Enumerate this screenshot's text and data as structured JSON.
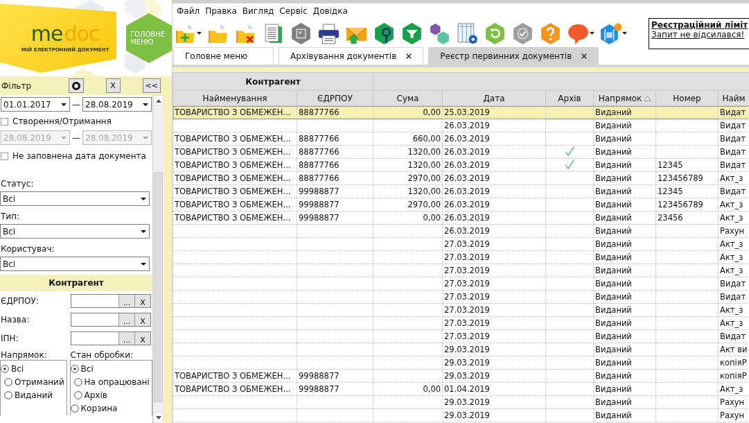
{
  "logo": {
    "brand": [
      "me",
      "doc"
    ],
    "tagline": "МІЙ ЕЛЕКТРОННИЙ ДОКУМЕНТ"
  },
  "main_menu_button": "ГОЛОВНЕ МЕНЮ",
  "menu": [
    "Файл",
    "Правка",
    "Вигляд",
    "Сервіс",
    "Довідка"
  ],
  "toolbar": [
    {
      "kind": "new",
      "dropdown": true
    },
    {
      "kind": "open"
    },
    {
      "kind": "delete"
    },
    {
      "kind": "copy"
    },
    {
      "kind": "archive"
    },
    {
      "kind": "print"
    },
    {
      "kind": "send"
    },
    {
      "kind": "search"
    },
    {
      "kind": "filter"
    },
    {
      "kind": "group"
    },
    {
      "kind": "columns"
    },
    {
      "kind": "refresh"
    },
    {
      "kind": "sign"
    },
    {
      "kind": "help"
    },
    {
      "kind": "chat",
      "dropdown": true
    },
    {
      "kind": "video",
      "dropdown": true
    }
  ],
  "registration": {
    "title": "Реєстраційний ліміт",
    "link": "Запит не відсилався!"
  },
  "tabs": [
    {
      "label": "Головне меню",
      "closable": false,
      "selected": false
    },
    {
      "label": "Архівування документів",
      "closable": true,
      "selected": false
    },
    {
      "label": "Реєстр первинних документів",
      "closable": true,
      "selected": true
    }
  ],
  "filter": {
    "title": "Фільтр",
    "clear_button": "X",
    "collapse_button": "<<",
    "date_range": {
      "from": "01.01.2017",
      "separator": "—",
      "to": "28.08.2019",
      "disabled": false
    },
    "created_checkbox": {
      "label": "Створення/Отримання",
      "checked": false
    },
    "created_range": {
      "from": "28.08.2019",
      "separator": "—",
      "to": "28.08.2019",
      "disabled": true
    },
    "empty_date_checkbox": {
      "label": "Не заповнена дата документа",
      "checked": false
    },
    "selects": [
      {
        "label": "Статус:",
        "value": "Всі"
      },
      {
        "label": "Тип:",
        "value": "Всі"
      },
      {
        "label": "Користувач:",
        "value": "Всі"
      }
    ],
    "counterparty": {
      "title": "Контрагент",
      "fields": [
        {
          "label": "ЄДРПОУ:",
          "browse": "...",
          "clear": "X"
        },
        {
          "label": "Назва:",
          "browse": "...",
          "clear": "X"
        },
        {
          "label": "ІПН:",
          "browse": "...",
          "clear": "X"
        }
      ]
    },
    "direction": {
      "label": "Напрямок:",
      "options": [
        {
          "label": "Всі",
          "selected": true
        },
        {
          "label": "Отриманий",
          "selected": false
        },
        {
          "label": "Виданий",
          "selected": false
        }
      ]
    },
    "processing": {
      "label": "Стан обробки:",
      "options": [
        {
          "label": "Всі",
          "selected": true
        },
        {
          "label": "На опрацювані",
          "selected": false
        },
        {
          "label": "Архів",
          "selected": false
        },
        {
          "label": "Корзина",
          "selected": false
        }
      ]
    }
  },
  "table": {
    "group_header": "Контрагент",
    "columns": [
      {
        "label": "Найменування"
      },
      {
        "label": "ЄДРПОУ"
      },
      {
        "label": "Сума"
      },
      {
        "label": "Дата"
      },
      {
        "label": "Архів"
      },
      {
        "label": "Напрямок",
        "sorted": true
      },
      {
        "label": "Номер"
      },
      {
        "label": "Найм"
      }
    ],
    "rows": [
      {
        "name": "ТОВАРИСТВО З ОБМЕЖЕН...",
        "edrpou": "88877766",
        "sum": "0,00",
        "date": "25.03.2019",
        "archived": false,
        "direction": "Виданий",
        "title": "Видат",
        "selected": true
      },
      {
        "date": "26.03.2019",
        "archived": false,
        "direction": "Виданий",
        "title": "Видат",
        "selected": false
      },
      {
        "name": "ТОВАРИСТВО З ОБМЕЖЕН...",
        "edrpou": "88877766",
        "sum": "660,00",
        "date": "26.03.2019",
        "archived": false,
        "direction": "Виданий",
        "title": "Видат",
        "selected": false
      },
      {
        "name": "ТОВАРИСТВО З ОБМЕЖЕН...",
        "edrpou": "88877766",
        "sum": "1320,00",
        "date": "26.03.2019",
        "archived": true,
        "direction": "Виданий",
        "title": "Видат",
        "selected": false
      },
      {
        "name": "ТОВАРИСТВО З ОБМЕЖЕН...",
        "edrpou": "88877766",
        "sum": "1320,00",
        "date": "26.03.2019",
        "archived": true,
        "direction": "Виданий",
        "number": "12345",
        "title": "Видат",
        "selected": false
      },
      {
        "name": "ТОВАРИСТВО З ОБМЕЖЕН...",
        "edrpou": "88877766",
        "sum": "2970,00",
        "date": "26.03.2019",
        "archived": false,
        "direction": "Виданий",
        "number": "123456789",
        "title": "Акт_з",
        "selected": false
      },
      {
        "name": "ТОВАРИСТВО З ОБМЕЖЕН...",
        "edrpou": "99988877",
        "sum": "1320,00",
        "date": "26.03.2019",
        "archived": false,
        "direction": "Виданий",
        "number": "12345",
        "title": "Видат",
        "selected": false
      },
      {
        "name": "ТОВАРИСТВО З ОБМЕЖЕН...",
        "edrpou": "99988877",
        "sum": "2970,00",
        "date": "26.03.2019",
        "archived": false,
        "direction": "Виданий",
        "number": "123456789",
        "title": "Акт_з",
        "selected": false
      },
      {
        "name": "ТОВАРИСТВО З ОБМЕЖЕН...",
        "edrpou": "99988877",
        "sum": "0,00",
        "date": "26.03.2019",
        "archived": false,
        "direction": "Виданий",
        "number": "23456",
        "title": "Акт_з",
        "selected": false
      },
      {
        "date": "26.03.2019",
        "archived": false,
        "direction": "Виданий",
        "title": "Рахун",
        "selected": false
      },
      {
        "date": "27.03.2019",
        "archived": false,
        "direction": "Виданий",
        "title": "Акт_з",
        "selected": false
      },
      {
        "date": "27.03.2019",
        "archived": false,
        "direction": "Виданий",
        "title": "Акт_з",
        "selected": false
      },
      {
        "date": "27.03.2019",
        "archived": false,
        "direction": "Виданий",
        "title": "Акт_з",
        "selected": false
      },
      {
        "date": "27.03.2019",
        "archived": false,
        "direction": "Виданий",
        "title": "Видат",
        "selected": false
      },
      {
        "date": "27.03.2019",
        "archived": false,
        "direction": "Виданий",
        "title": "Видат",
        "selected": false
      },
      {
        "date": "27.03.2019",
        "archived": false,
        "direction": "Виданий",
        "title": "Акт_з",
        "selected": false
      },
      {
        "date": "27.03.2019",
        "archived": false,
        "direction": "Виданий",
        "title": "Акт_з",
        "selected": false
      },
      {
        "date": "27.03.2019",
        "archived": false,
        "direction": "Виданий",
        "title": "Видат",
        "selected": false
      },
      {
        "date": "29.03.2019",
        "archived": false,
        "direction": "Виданий",
        "title": "Акт ви",
        "selected": false
      },
      {
        "date": "29.03.2019",
        "archived": false,
        "direction": "Виданий",
        "title": "копіяР",
        "selected": false
      },
      {
        "name": "ТОВАРИСТВО З ОБМЕЖЕН...",
        "edrpou": "99988877",
        "date": "29.03.2019",
        "archived": false,
        "direction": "Виданий",
        "title": "копіяР",
        "selected": false
      },
      {
        "name": "ТОВАРИСТВО З ОБМЕЖЕН...",
        "edrpou": "99988877",
        "sum": "0,00",
        "date": "01.04.2019",
        "archived": false,
        "direction": "Виданий",
        "title": "Акт_з",
        "selected": false
      },
      {
        "date": "29.03.2019",
        "archived": false,
        "direction": "Виданий",
        "title": "Рахун",
        "selected": false
      },
      {
        "date": "29.03.2019",
        "archived": false,
        "direction": "Виданий",
        "title": "Рахун",
        "selected": false
      }
    ]
  }
}
